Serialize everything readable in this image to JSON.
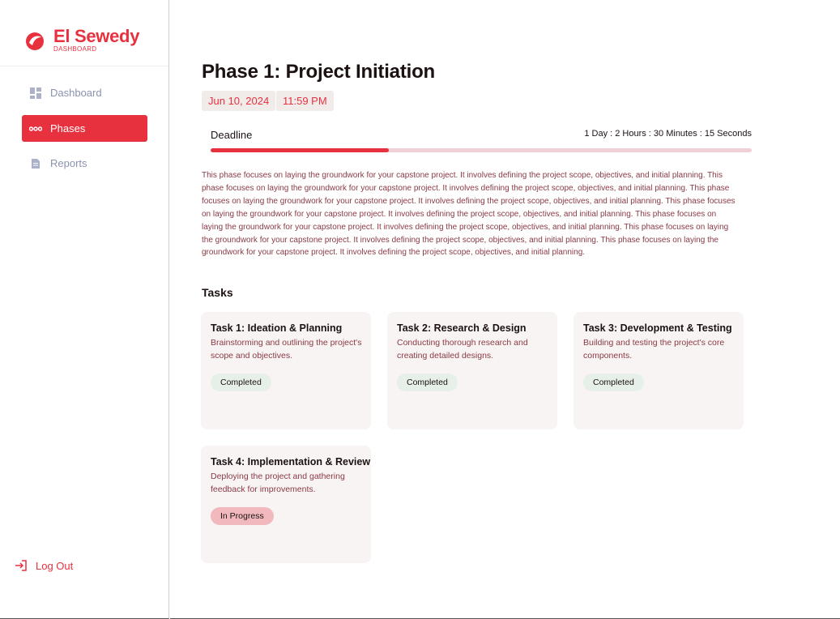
{
  "brand": {
    "name": "El Sewedy",
    "subtitle": "DASHBOARD",
    "accent_color": "#e8313f"
  },
  "sidebar": {
    "items": [
      {
        "label": "Dashboard",
        "icon": "dashboard-grid-icon",
        "active": false
      },
      {
        "label": "Phases",
        "icon": "phases-dots-icon",
        "active": true
      },
      {
        "label": "Reports",
        "icon": "document-icon",
        "active": false
      }
    ],
    "logout": {
      "label": "Log Out",
      "icon": "logout-icon"
    }
  },
  "phase": {
    "title": "Phase 1: Project Initiation",
    "date": "Jun 10, 2024",
    "time": "11:59 PM",
    "deadline_label": "Deadline",
    "countdown": "1 Day : 2 Hours : 30 Minutes : 15 Seconds",
    "progress_percent": 33,
    "description": "This phase focuses on laying the groundwork for your capstone project. It involves defining the project scope, objectives, and initial planning. This phase focuses on laying the groundwork for your capstone project. It involves defining the project scope, objectives, and initial planning. This phase focuses on laying the groundwork for your capstone project. It involves defining the project scope, objectives, and initial planning. This phase focuses on laying the groundwork for your capstone project. It involves defining the project scope, objectives, and initial planning. This phase focuses on laying the groundwork for your capstone project. It involves defining the project scope, objectives, and initial planning. This phase focuses on laying the groundwork for your capstone project. It involves defining the project scope, objectives, and initial planning. This phase focuses on laying the groundwork for your capstone project. It involves defining the project scope, objectives, and initial planning."
  },
  "tasks": {
    "heading": "Tasks",
    "items": [
      {
        "title": "Task 1: Ideation & Planning",
        "description": "Brainstorming and outlining the project's scope and objectives.",
        "status": "Completed"
      },
      {
        "title": "Task 2: Research & Design",
        "description": "Conducting thorough research and creating detailed designs.",
        "status": "Completed"
      },
      {
        "title": "Task 3: Development & Testing",
        "description": "Building and testing the project's core components.",
        "status": "Completed"
      },
      {
        "title": "Task 4: Implementation & Review",
        "description": "Deploying the project and gathering feedback for improvements.",
        "status": "In Progress"
      }
    ]
  },
  "colors": {
    "status_completed_bg": "#e6f0e8",
    "status_in_progress_bg": "#f1b9bd",
    "progress_track": "#f0d0d4"
  }
}
